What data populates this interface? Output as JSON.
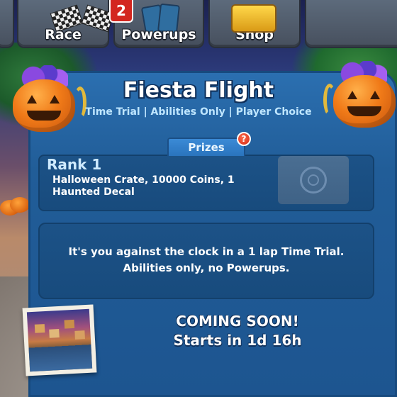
{
  "tabs": [
    {
      "label": "Race"
    },
    {
      "label": "Powerups",
      "badge": "2"
    },
    {
      "label": "Shop"
    }
  ],
  "event": {
    "title": "Fiesta Flight",
    "subtitle": "Time Trial | Abilities Only | Player Choice"
  },
  "prizes": {
    "tab_label": "Prizes",
    "help_glyph": "?",
    "rank": "Rank 1",
    "reward": "Halloween Crate, 10000 Coins, 1 Haunted Decal"
  },
  "description": {
    "line1": "It's you against the clock in a 1 lap Time Trial.",
    "line2": "Abilities only, no Powerups."
  },
  "status": {
    "headline": "COMING SOON!",
    "countdown": "Starts in 1d 16h"
  },
  "colors": {
    "panel": "#215d98",
    "badge": "#d3261f",
    "accent_text": "#bfe6ff"
  }
}
